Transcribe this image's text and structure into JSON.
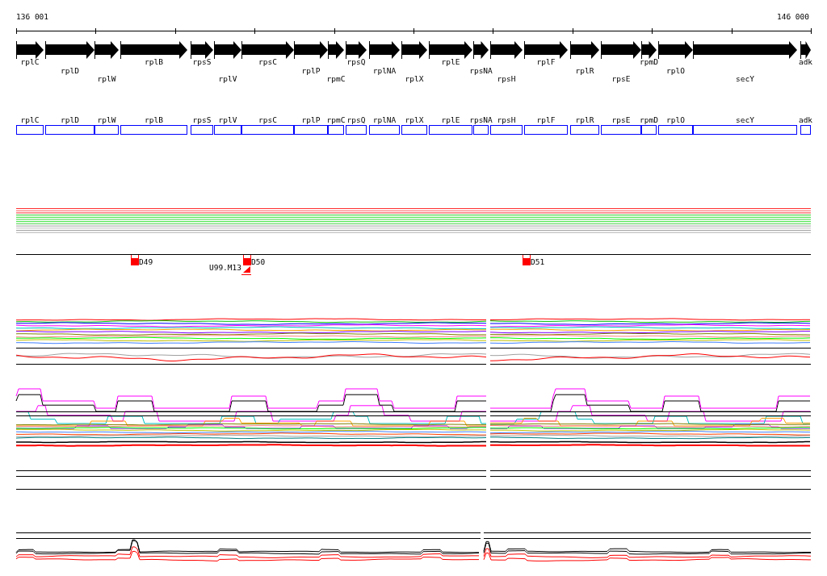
{
  "ruler": {
    "start": "136 001",
    "end": "146 000"
  },
  "genes": [
    {
      "name": "rplC"
    },
    {
      "name": "rplD"
    },
    {
      "name": "rplW"
    },
    {
      "name": "rplB"
    },
    {
      "name": "rpsS"
    },
    {
      "name": "rplV"
    },
    {
      "name": "rpsC"
    },
    {
      "name": "rplP"
    },
    {
      "name": "rpmC"
    },
    {
      "name": "rpsQ"
    },
    {
      "name": "rplNA"
    },
    {
      "name": "rplX"
    },
    {
      "name": "rplE"
    },
    {
      "name": "rpsNA"
    },
    {
      "name": "rpsH"
    },
    {
      "name": "rplF"
    },
    {
      "name": "rplR"
    },
    {
      "name": "rpsE"
    },
    {
      "name": "rpmD"
    },
    {
      "name": "rplO"
    },
    {
      "name": "secY"
    },
    {
      "name": "adk"
    }
  ],
  "gene_boxes": [
    {
      "name": "rplC"
    },
    {
      "name": "rplD"
    },
    {
      "name": "rplW"
    },
    {
      "name": "rplB"
    },
    {
      "name": "rpsS"
    },
    {
      "name": "rplV"
    },
    {
      "name": "rpsC"
    },
    {
      "name": "rplP"
    },
    {
      "name": "rpmC"
    },
    {
      "name": "rpsQ"
    },
    {
      "name": "rplNA"
    },
    {
      "name": "rplX"
    },
    {
      "name": "rplE"
    },
    {
      "name": "rpsNA"
    },
    {
      "name": "rpsH"
    },
    {
      "name": "rplF"
    },
    {
      "name": "rplR"
    },
    {
      "name": "rpsE"
    },
    {
      "name": "rpmD"
    },
    {
      "name": "rplO"
    },
    {
      "name": "secY"
    },
    {
      "name": "adk"
    }
  ],
  "markers": [
    {
      "label": "D49"
    },
    {
      "label": "D50"
    },
    {
      "label": "D51"
    }
  ],
  "features": [
    {
      "label": "U99.M13"
    }
  ]
}
